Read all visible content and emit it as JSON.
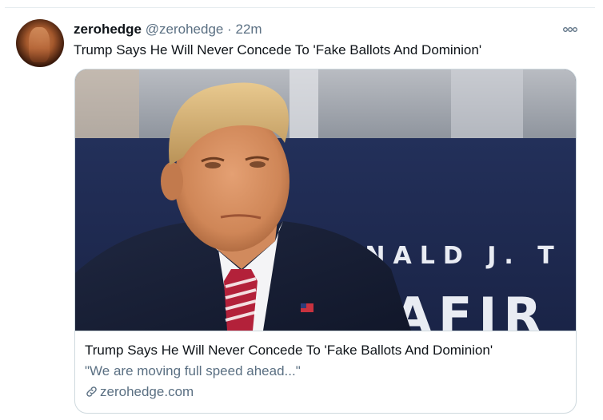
{
  "tweet": {
    "display_name": "zerohedge",
    "handle": "@zerohedge",
    "separator": "·",
    "time": "22m",
    "more_icon": "more-horizontal-icon",
    "text": "Trump Says He Will Never Concede To 'Fake Ballots And Dominion'"
  },
  "card": {
    "image_backdrop_text": "DONALD J. T",
    "image_backdrop_text_lower": "AFIR",
    "title": "Trump Says He Will Never Concede To 'Fake Ballots And Dominion'",
    "description": "\"We are moving full speed ahead...\"",
    "domain": "zerohedge.com",
    "link_icon": "link-icon"
  },
  "colors": {
    "text_primary": "#0f1419",
    "text_secondary": "#5b7083",
    "border": "#cfd9de",
    "backdrop_navy": "#1e2a4a"
  }
}
